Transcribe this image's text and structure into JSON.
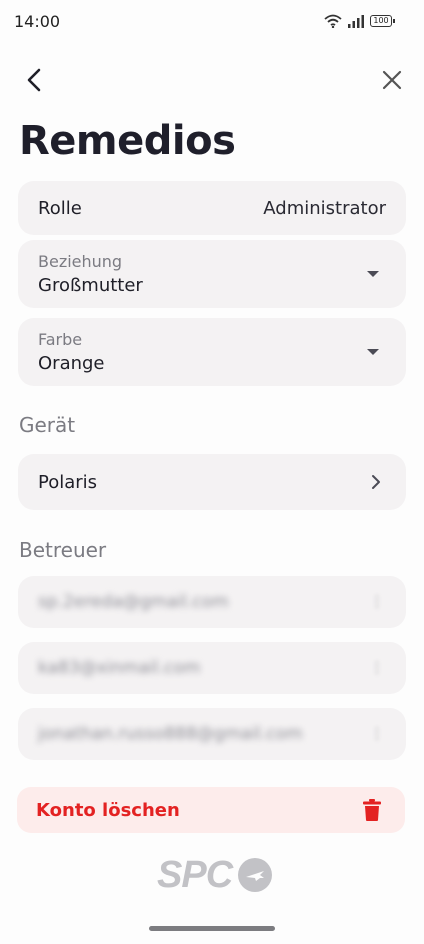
{
  "status_bar": {
    "time": "14:00",
    "battery": "100",
    "icons": [
      "wifi-icon",
      "signal-icon",
      "battery-icon"
    ]
  },
  "nav": {
    "back_icon": "chevron-left-icon",
    "close_icon": "close-icon"
  },
  "title": "Remedios",
  "role": {
    "label": "Rolle",
    "value": "Administrator"
  },
  "relationship": {
    "label": "Beziehung",
    "value": "Großmutter"
  },
  "color": {
    "label": "Farbe",
    "value": "Orange"
  },
  "device_section": {
    "title": "Gerät",
    "device_name": "Polaris"
  },
  "carers_section": {
    "title": "Betreuer",
    "items": [
      {
        "email": "sp.2ereda@gmail.com"
      },
      {
        "email": "ka83@xinmail.com"
      },
      {
        "email": "jonathan.russo888@gmail.com"
      }
    ]
  },
  "delete": {
    "label": "Konto löschen",
    "icon": "trash-icon"
  },
  "logo": {
    "text": "SPC"
  },
  "colors": {
    "danger": "#e32222",
    "danger_bg": "#fdeceb",
    "card_bg": "#f4f2f3",
    "muted": "#7b7b82"
  }
}
